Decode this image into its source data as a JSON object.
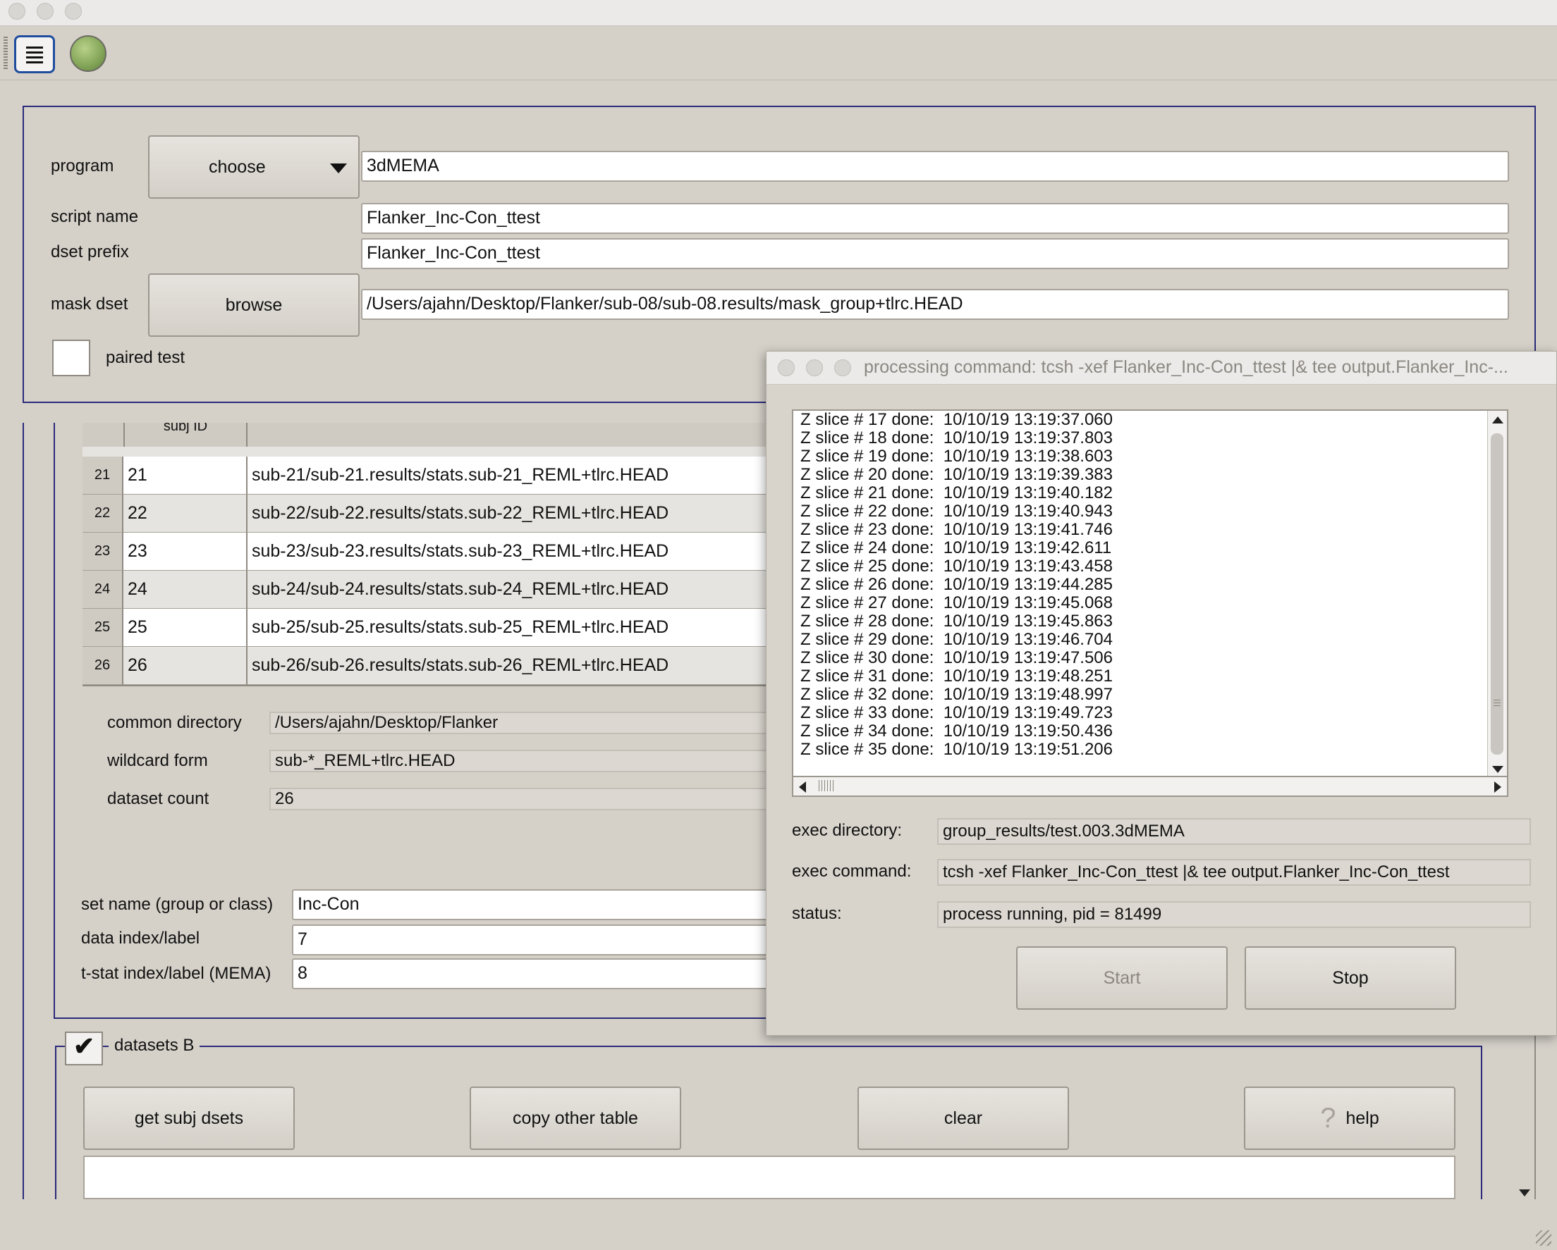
{
  "main": {
    "program_label": "program",
    "program_choose": "choose",
    "program_value": "3dMEMA",
    "script_name_label": "script name",
    "script_name_value": "Flanker_Inc-Con_ttest",
    "dset_prefix_label": "dset prefix",
    "dset_prefix_value": "Flanker_Inc-Con_ttest",
    "mask_dset_label": "mask dset",
    "browse_label": "browse",
    "mask_dset_value": "/Users/ajahn/Desktop/Flanker/sub-08/sub-08.results/mask_group+tlrc.HEAD",
    "paired_test_label": "paired test",
    "paired_test_checked": false
  },
  "table": {
    "header_id": "subj ID",
    "rows": [
      {
        "num": "21",
        "id": "21",
        "dset": "sub-21/sub-21.results/stats.sub-21_REML+tlrc.HEAD"
      },
      {
        "num": "22",
        "id": "22",
        "dset": "sub-22/sub-22.results/stats.sub-22_REML+tlrc.HEAD"
      },
      {
        "num": "23",
        "id": "23",
        "dset": "sub-23/sub-23.results/stats.sub-23_REML+tlrc.HEAD"
      },
      {
        "num": "24",
        "id": "24",
        "dset": "sub-24/sub-24.results/stats.sub-24_REML+tlrc.HEAD"
      },
      {
        "num": "25",
        "id": "25",
        "dset": "sub-25/sub-25.results/stats.sub-25_REML+tlrc.HEAD"
      },
      {
        "num": "26",
        "id": "26",
        "dset": "sub-26/sub-26.results/stats.sub-26_REML+tlrc.HEAD"
      }
    ]
  },
  "info": {
    "common_directory_label": "common directory",
    "common_directory_value": "/Users/ajahn/Desktop/Flanker",
    "wildcard_form_label": "wildcard form",
    "wildcard_form_value": "sub-*_REML+tlrc.HEAD",
    "dataset_count_label": "dataset count",
    "dataset_count_value": "26"
  },
  "set": {
    "set_name_label": "set name (group or class)",
    "set_name_value": "Inc-Con",
    "data_index_label": "data index/label",
    "data_index_value": "7",
    "tstat_index_label": "t-stat index/label (MEMA)",
    "tstat_index_value": "8"
  },
  "datasets_b": {
    "label": "datasets B",
    "checked": true,
    "get_subj_dsets": "get subj dsets",
    "copy_other_table": "copy other table",
    "clear": "clear",
    "help_icon": "?",
    "help": "help"
  },
  "proc": {
    "title": "processing command: tcsh -xef Flanker_Inc-Con_ttest |& tee output.Flanker_Inc-...",
    "log_lines": [
      "Z slice # 17 done:  10/10/19 13:19:37.060",
      "Z slice # 18 done:  10/10/19 13:19:37.803",
      "Z slice # 19 done:  10/10/19 13:19:38.603",
      "Z slice # 20 done:  10/10/19 13:19:39.383",
      "Z slice # 21 done:  10/10/19 13:19:40.182",
      "Z slice # 22 done:  10/10/19 13:19:40.943",
      "Z slice # 23 done:  10/10/19 13:19:41.746",
      "Z slice # 24 done:  10/10/19 13:19:42.611",
      "Z slice # 25 done:  10/10/19 13:19:43.458",
      "Z slice # 26 done:  10/10/19 13:19:44.285",
      "Z slice # 27 done:  10/10/19 13:19:45.068",
      "Z slice # 28 done:  10/10/19 13:19:45.863",
      "Z slice # 29 done:  10/10/19 13:19:46.704",
      "Z slice # 30 done:  10/10/19 13:19:47.506",
      "Z slice # 31 done:  10/10/19 13:19:48.251",
      "Z slice # 32 done:  10/10/19 13:19:48.997",
      "Z slice # 33 done:  10/10/19 13:19:49.723",
      "Z slice # 34 done:  10/10/19 13:19:50.436",
      "Z slice # 35 done:  10/10/19 13:19:51.206"
    ],
    "exec_directory_label": "exec directory:",
    "exec_directory_value": "group_results/test.003.3dMEMA",
    "exec_command_label": "exec command:",
    "exec_command_value": "tcsh -xef Flanker_Inc-Con_ttest |& tee output.Flanker_Inc-Con_ttest",
    "status_label": "status:",
    "status_value": "process running, pid = 81499",
    "start_label": "Start",
    "stop_label": "Stop"
  },
  "icons": {
    "menu": "menu-icon",
    "globe": "globe-icon"
  }
}
